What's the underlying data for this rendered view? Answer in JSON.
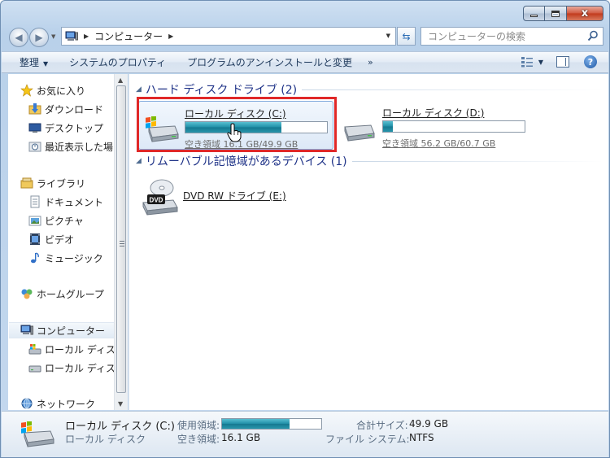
{
  "window": {
    "caption_min": "",
    "caption_max": "",
    "caption_close": "x"
  },
  "address": {
    "crumb": "コンピューター",
    "search_placeholder": "コンピューターの検索"
  },
  "toolbar": {
    "organize": "整理",
    "system_properties": "システムのプロパティ",
    "uninstall": "プログラムのアンインストールと変更",
    "more": "»",
    "help": "?"
  },
  "nav": {
    "favorites": "お気に入り",
    "downloads": "ダウンロード",
    "desktop": "デスクトップ",
    "recent": "最近表示した場",
    "libraries": "ライブラリ",
    "documents": "ドキュメント",
    "pictures": "ピクチャ",
    "videos": "ビデオ",
    "music": "ミュージック",
    "homegroup": "ホームグループ",
    "computer": "コンピューター",
    "local_c": "ローカル ディス",
    "local_d": "ローカル ディス",
    "network": "ネットワーク"
  },
  "groups": {
    "hard_disks": "ハード ディスク ドライブ (2)",
    "removable": "リムーバブル記憶域があるデバイス (1)"
  },
  "drives": {
    "c": {
      "name": "ローカル ディスク (C:)",
      "free": "空き領域 16.1 GB/49.9 GB",
      "used_fraction": 0.68
    },
    "d": {
      "name": "ローカル ディスク (D:)",
      "free": "空き領域 56.2 GB/60.7 GB",
      "used_fraction": 0.07
    },
    "dvd": {
      "name": "DVD RW ドライブ (E:)",
      "label": "DVD"
    }
  },
  "details": {
    "name": "ローカル ディスク (C:)",
    "type": "ローカル ディスク",
    "used_label": "使用領域:",
    "used_fraction": 0.68,
    "free_label": "空き領域:",
    "free_value": "16.1 GB",
    "total_label": "合計サイズ:",
    "total_value": "49.9 GB",
    "fs_label": "ファイル システム:",
    "fs_value": "NTFS"
  }
}
